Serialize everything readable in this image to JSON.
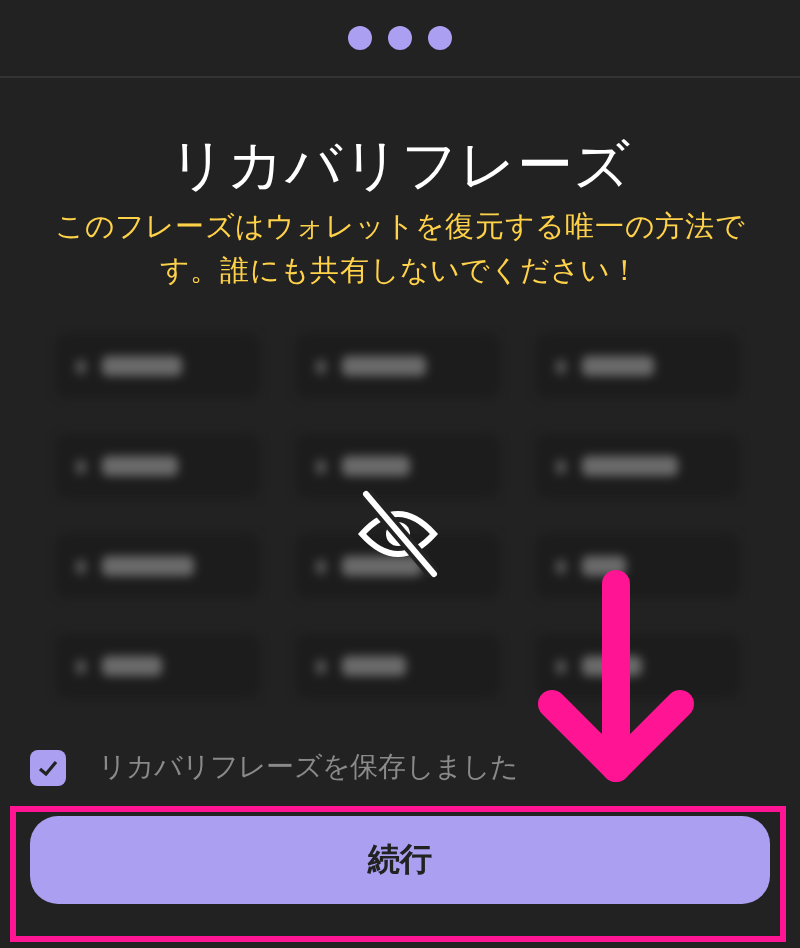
{
  "step_dots": [
    {
      "active": true
    },
    {
      "active": true
    },
    {
      "active": true
    }
  ],
  "title": "リカバリフレーズ",
  "warning": "このフレーズはウォレットを復元する唯一の方法です。誰にも共有しないでください！",
  "phrase_grid": {
    "hidden": true,
    "cells": [
      {
        "hidden": true
      },
      {
        "hidden": true
      },
      {
        "hidden": true
      },
      {
        "hidden": true
      },
      {
        "hidden": true
      },
      {
        "hidden": true
      },
      {
        "hidden": true
      },
      {
        "hidden": true
      },
      {
        "hidden": true
      },
      {
        "hidden": true
      },
      {
        "hidden": true
      },
      {
        "hidden": true
      }
    ]
  },
  "saved_checkbox": {
    "label": "リカバリフレーズを保存しました",
    "checked": true
  },
  "continue_button": {
    "label": "続行"
  }
}
